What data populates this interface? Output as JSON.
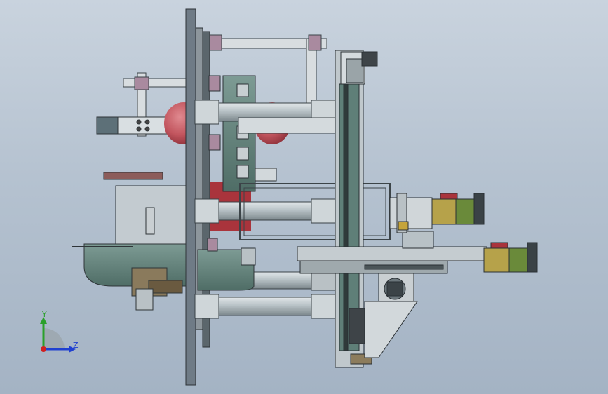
{
  "viewport": {
    "colors": {
      "background_top": "#c9d3de",
      "background_bottom": "#a4b3c4",
      "plate": "#6f7b86",
      "steel": "#b8c2c6",
      "steel_dark": "#4a5358",
      "green_part": "#5f7f78",
      "pink_part": "#a98a9f",
      "red_vessel": "#c2555e",
      "motor_gold": "#b6a24a",
      "motor_green": "#6a8a3a"
    }
  },
  "triad": {
    "y_label": "Y",
    "z_label": "Z",
    "y_color": "#2aa02a",
    "z_color": "#2040d0",
    "origin_color": "#d02020"
  }
}
